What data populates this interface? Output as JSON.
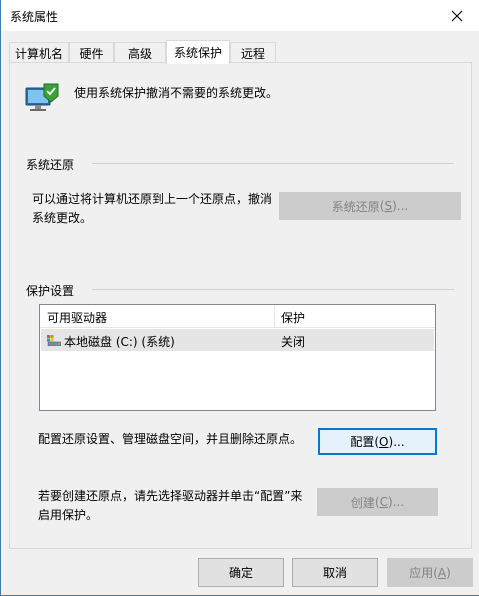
{
  "window": {
    "title": "系统属性"
  },
  "tabs": [
    {
      "label": "计算机名"
    },
    {
      "label": "硬件"
    },
    {
      "label": "高级"
    },
    {
      "label": "系统保护"
    },
    {
      "label": "远程"
    }
  ],
  "intro": {
    "text": "使用系统保护撤消不需要的系统更改。"
  },
  "restore": {
    "group_label": "系统还原",
    "description": "可以通过将计算机还原到上一个还原点，撤消系统更改。",
    "button_text": "系统还原",
    "button_key": "S",
    "button_suffix": "..."
  },
  "protection": {
    "group_label": "保护设置",
    "columns": [
      "可用驱动器",
      "保护"
    ],
    "rows": [
      {
        "drive": "本地磁盘 (C:) (系统)",
        "status": "关闭"
      }
    ],
    "configure_text": "配置还原设置、管理磁盘空间，并且删除还原点。",
    "configure_button": "配置",
    "configure_key": "O",
    "configure_suffix": "...",
    "create_text": "若要创建还原点，请先选择驱动器并单击“配置”来启用保护。",
    "create_button": "创建",
    "create_key": "C",
    "create_suffix": "..."
  },
  "footer": {
    "ok": "确定",
    "cancel": "取消",
    "apply": "应用",
    "apply_key": "A"
  },
  "colors": {
    "accent": "#0078d7",
    "disabled_text": "#838383"
  }
}
